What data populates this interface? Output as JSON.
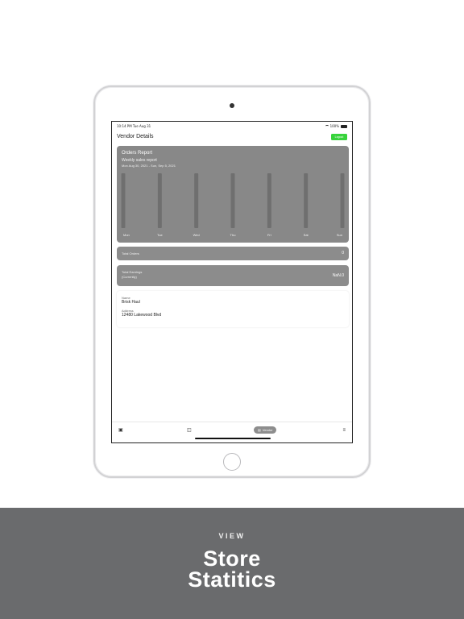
{
  "status_bar": {
    "time": "10:14 PM  Tue Aug 31",
    "battery": "100%"
  },
  "header": {
    "title": "Vendor Details",
    "action_label": "Logout"
  },
  "chart_data": {
    "type": "bar",
    "title": "Orders Report",
    "subtitle": "Weekly sales report",
    "range": "Mon Aug 30, 2021  -  Sun, Sep 5, 2021",
    "categories": [
      "Mon",
      "Tue",
      "Wed",
      "Thu",
      "Fri",
      "Sat",
      "Sun"
    ],
    "values": [
      0,
      0,
      0,
      0,
      0,
      0,
      0
    ]
  },
  "summary": {
    "total_orders_label": "Total Orders",
    "total_orders_value": "0",
    "earnings_label_1": "Total Earnings",
    "earnings_label_2": "(Currently)",
    "earnings_value": "NaN.0"
  },
  "details": {
    "name_label": "Name",
    "name_value": "Brisk Haul",
    "address_label": "Address",
    "address_value": "12480 Lakewood Blvd"
  },
  "nav": {
    "home_icon": "store-icon",
    "scan_icon": "scan-icon",
    "vendor_label": "Vendor",
    "menu_icon": "menu-icon"
  },
  "banner": {
    "kicker": "VIEW",
    "line1": "Store",
    "line2": "Statitics"
  },
  "colors": {
    "accent": "#37d33b",
    "card": "#888888",
    "banner": "#6a6b6d"
  }
}
